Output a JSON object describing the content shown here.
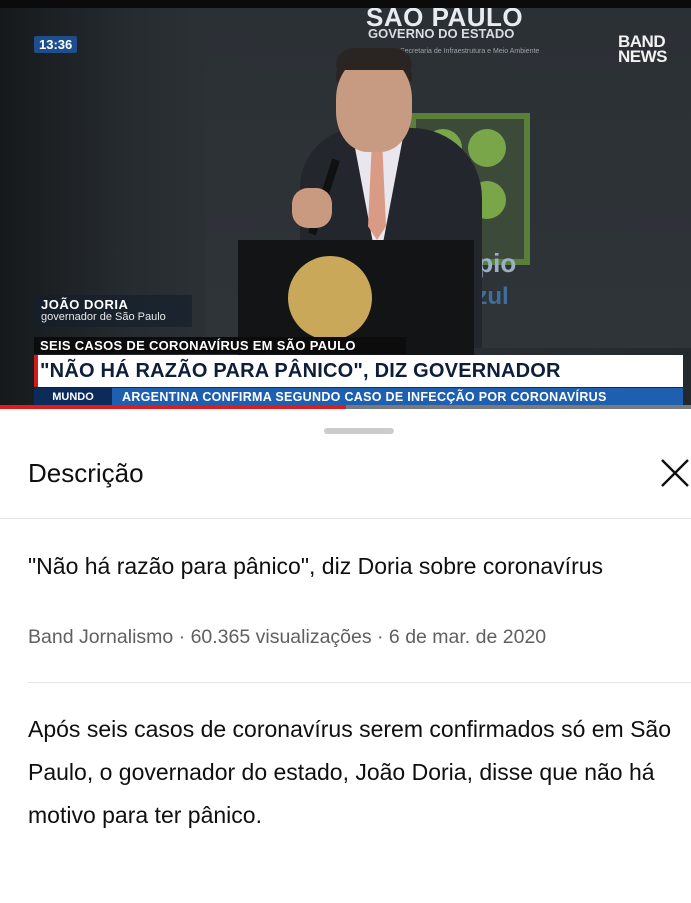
{
  "video": {
    "timestamp": "13:36",
    "channel_logo": "BAND NEWS",
    "backdrop_logo_title": "SÃO PAULO",
    "backdrop_logo_subtitle": "GOVERNO DO ESTADO",
    "backdrop_logo_small": "Secretaria de Infraestrutura e Meio Ambiente",
    "backdrop_word_1": "ípio",
    "backdrop_word_2": "azul",
    "name_tag": {
      "name": "JOÃO DORIA",
      "role": "governador de São Paulo"
    },
    "lower_third": {
      "kicker": "SEIS CASOS DE CORONAVÍRUS EM SÃO PAULO",
      "headline": "\"NÃO HÁ RAZÃO PARA PÂNICO\", DIZ GOVERNADOR",
      "section": "MUNDO",
      "ticker": "ARGENTINA CONFIRMA SEGUNDO CASO DE INFECÇÃO POR CORONAVÍRUS"
    },
    "progress_fraction": 0.5
  },
  "sheet": {
    "title": "Descrição",
    "close_icon": "close-icon",
    "video_title": "\"Não há razão para pânico\", diz Doria sobre coronavírus",
    "meta": "Band Jornalismo · 60.365 visualizações · 6 de mar. de 2020",
    "description": "Após seis casos de coronavírus serem confirmados só em São Paulo, o governador do estado, João Doria, disse que não há motivo para ter pânico."
  },
  "colors": {
    "progress": "#e01b1b",
    "ticker_bar": "#1f5fb0",
    "headline_text": "#0e1e3a"
  }
}
